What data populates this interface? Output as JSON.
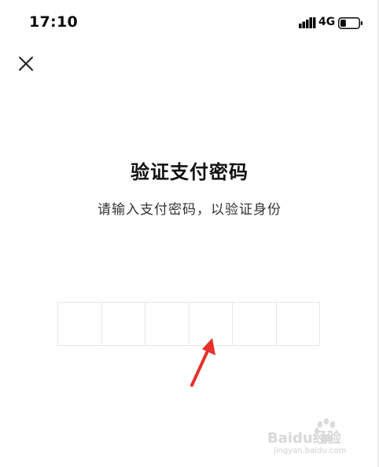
{
  "status_bar": {
    "time": "17:10",
    "network": "4G",
    "battery_level": 0.3
  },
  "header": {
    "close_icon": "close-icon"
  },
  "main": {
    "title": "验证支付密码",
    "subtitle": "请输入支付密码，以验证身份",
    "password_length": 6
  },
  "annotation": {
    "arrow_color": "#e8302a"
  },
  "watermark": {
    "brand": "Baidu经验",
    "sub": "jingyan.baidu.com"
  }
}
